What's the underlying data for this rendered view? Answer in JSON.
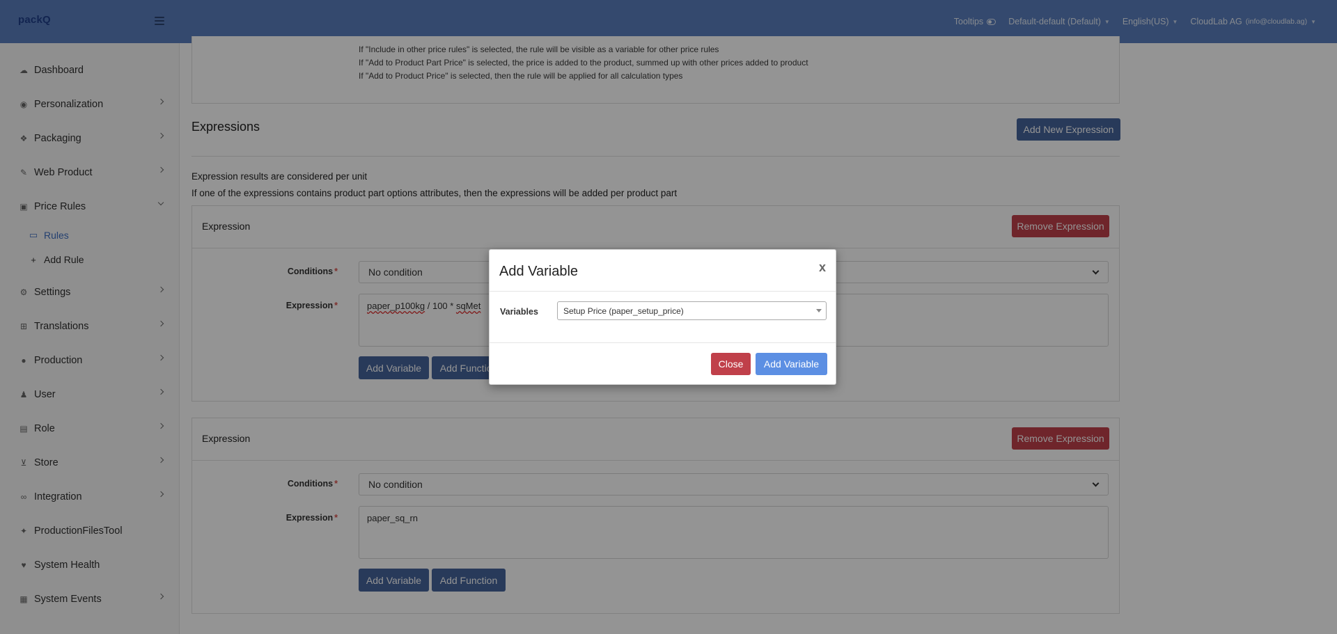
{
  "topbar": {
    "logo": "packQ",
    "tooltips_label": "Tooltips",
    "workspace": "Default-default (Default)",
    "language": "English(US)",
    "account_name": "CloudLab AG",
    "account_email": "(info@cloudlab.ag)"
  },
  "sidebar": {
    "items": [
      {
        "label": "Dashboard",
        "icon": "cloud-icon"
      },
      {
        "label": "Personalization",
        "icon": "eye-icon"
      },
      {
        "label": "Packaging",
        "icon": "boxes-icon"
      },
      {
        "label": "Web Product",
        "icon": "brush-icon"
      },
      {
        "label": "Price Rules",
        "icon": "price-tag-icon"
      },
      {
        "label": "Settings",
        "icon": "cogs-icon"
      },
      {
        "label": "Translations",
        "icon": "language-icon"
      },
      {
        "label": "Production",
        "icon": "production-icon"
      },
      {
        "label": "User",
        "icon": "user-icon"
      },
      {
        "label": "Role",
        "icon": "id-card-icon"
      },
      {
        "label": "Store",
        "icon": "cart-icon"
      },
      {
        "label": "Integration",
        "icon": "link-icon"
      },
      {
        "label": "ProductionFilesTool",
        "icon": "wrench-icon"
      },
      {
        "label": "System Health",
        "icon": "heartbeat-icon"
      },
      {
        "label": "System Events",
        "icon": "calendar-icon"
      }
    ],
    "sub_items": [
      {
        "label": "Rules",
        "icon": "money-bill-icon"
      },
      {
        "label": "Add Rule",
        "icon": "plus-icon"
      }
    ]
  },
  "info": {
    "lines": [
      "If \"Include in other price rules\" is selected, the rule will be visible as a variable for other price rules",
      "If \"Add to Product Part Price\" is selected, the price is added to the product, summed up with other prices added to product",
      "If \"Add to Product Price\" is selected, then the rule will be applied for all calculation types"
    ]
  },
  "expressions": {
    "title": "Expressions",
    "add_new_label": "Add New Expression",
    "note1": "Expression results are considered per unit",
    "note2": "If one of the expressions contains product part options attributes, then the expressions will be added per product part",
    "cards": [
      {
        "title": "Expression",
        "remove_label": "Remove Expression",
        "conditions_label": "Conditions",
        "conditions_value": "No condition",
        "expression_label": "Expression",
        "expression_value_a": "paper_p100kg",
        "expression_value_b": " / 100 * ",
        "expression_value_c": "sqMet",
        "add_variable_label": "Add Variable",
        "add_function_label": "Add Function"
      },
      {
        "title": "Expression",
        "remove_label": "Remove Expression",
        "conditions_label": "Conditions",
        "conditions_value": "No condition",
        "expression_label": "Expression",
        "expression_value": "paper_sq_rn",
        "add_variable_label": "Add Variable",
        "add_function_label": "Add Function"
      }
    ]
  },
  "modal": {
    "title": "Add Variable",
    "close_x": "x",
    "variables_label": "Variables",
    "selected_variable": "Setup Price (paper_setup_price)",
    "close_label": "Close",
    "add_variable_label": "Add Variable"
  },
  "required_mark": "*"
}
